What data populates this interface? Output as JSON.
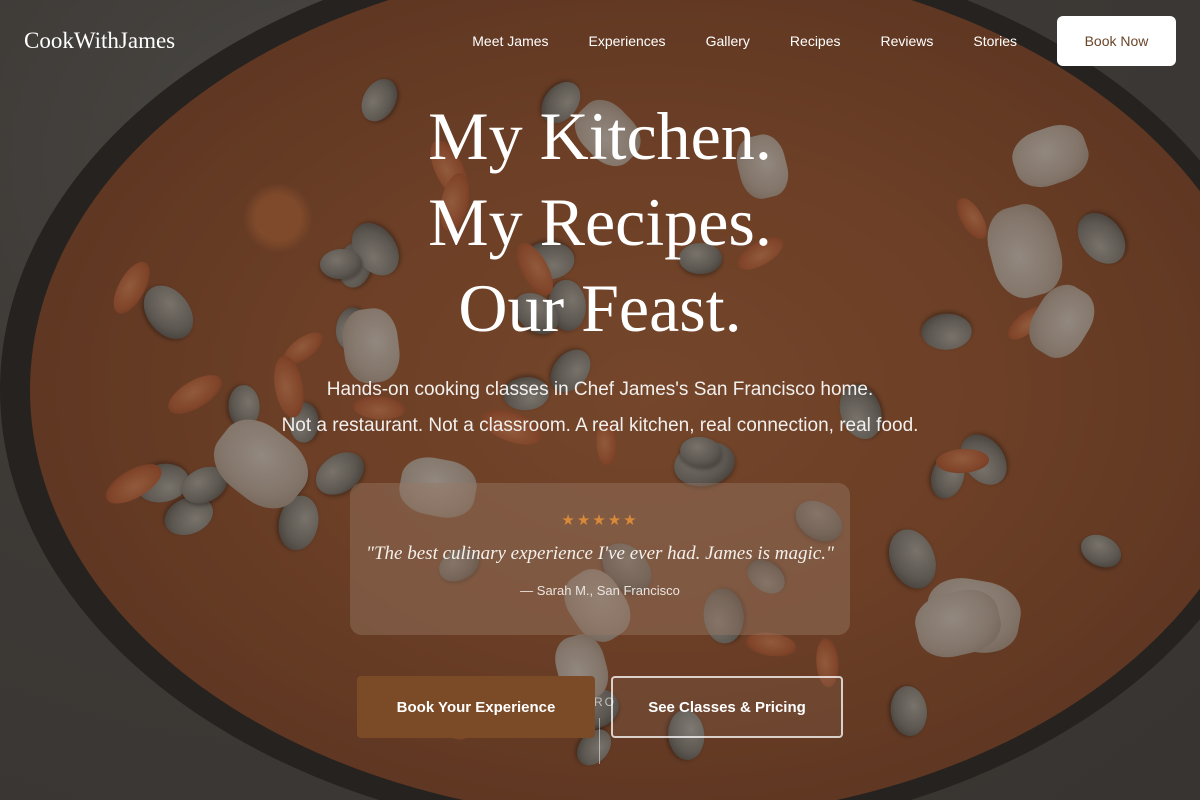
{
  "nav": {
    "logo": "CookWithJames",
    "links": [
      "Meet James",
      "Experiences",
      "Gallery",
      "Recipes",
      "Reviews",
      "Stories"
    ],
    "cta": "Book Now"
  },
  "hero": {
    "headline": [
      "My Kitchen.",
      "My Recipes.",
      "Our Feast."
    ],
    "subtext": [
      "Hands-on cooking classes in Chef James's San Francisco home.",
      "Not a restaurant. Not a classroom. A real kitchen, real connection, real food."
    ]
  },
  "testimonial": {
    "stars": "★★★★★",
    "quote": "\"The best culinary experience I've ever had. James is magic.\"",
    "author": "— Sarah M., San Francisco"
  },
  "cta": {
    "primary": "Book Your Experience",
    "secondary": "See Classes & Pricing",
    "scroll_hint": "RO"
  },
  "colors": {
    "accent_brown": "#7b4a26",
    "star_orange": "#d8893a",
    "book_now_text": "#6a4528"
  }
}
